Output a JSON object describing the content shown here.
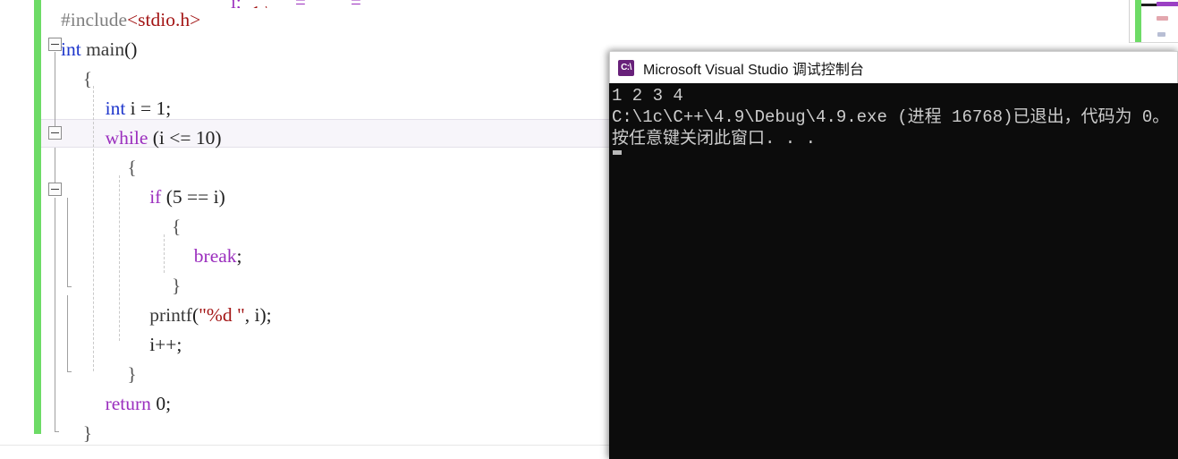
{
  "editor": {
    "name": "visual-studio-code-editor",
    "clipped_top_fragment": "i;  =    = ;",
    "lines": [
      {
        "indent": 0,
        "tokens": [
          {
            "t": "#include",
            "c": "tk-pre"
          },
          {
            "t": "<stdio.h>",
            "c": "tk-inc"
          }
        ]
      },
      {
        "indent": 0,
        "tokens": [
          {
            "t": "int",
            "c": "tk-type"
          },
          {
            "t": " ",
            "c": "tk-plain"
          },
          {
            "t": "main",
            "c": "tk-fn"
          },
          {
            "t": "()",
            "c": "tk-plain"
          }
        ]
      },
      {
        "indent": 1,
        "tokens": [
          {
            "t": "{",
            "c": "tk-brace"
          }
        ]
      },
      {
        "indent": 2,
        "tokens": [
          {
            "t": "int",
            "c": "tk-type"
          },
          {
            "t": " i = ",
            "c": "tk-plain"
          },
          {
            "t": "1",
            "c": "tk-num"
          },
          {
            "t": ";",
            "c": "tk-plain"
          }
        ]
      },
      {
        "indent": 2,
        "tokens": [
          {
            "t": "while",
            "c": "tk-kw"
          },
          {
            "t": " (i <= ",
            "c": "tk-plain"
          },
          {
            "t": "10",
            "c": "tk-num"
          },
          {
            "t": ")",
            "c": "tk-plain"
          }
        ]
      },
      {
        "indent": 3,
        "tokens": [
          {
            "t": "{",
            "c": "tk-brace"
          }
        ]
      },
      {
        "indent": 4,
        "tokens": [
          {
            "t": "if",
            "c": "tk-kw"
          },
          {
            "t": " (",
            "c": "tk-plain"
          },
          {
            "t": "5",
            "c": "tk-num"
          },
          {
            "t": " == i)",
            "c": "tk-plain"
          }
        ]
      },
      {
        "indent": 5,
        "tokens": [
          {
            "t": "{",
            "c": "tk-brace"
          }
        ]
      },
      {
        "indent": 6,
        "tokens": [
          {
            "t": "break",
            "c": "tk-kw"
          },
          {
            "t": ";",
            "c": "tk-plain"
          }
        ]
      },
      {
        "indent": 5,
        "tokens": [
          {
            "t": "}",
            "c": "tk-brace"
          }
        ]
      },
      {
        "indent": 4,
        "tokens": [
          {
            "t": "printf",
            "c": "tk-fn"
          },
          {
            "t": "(",
            "c": "tk-plain"
          },
          {
            "t": "\"%d \"",
            "c": "tk-str"
          },
          {
            "t": ", i);",
            "c": "tk-plain"
          }
        ]
      },
      {
        "indent": 4,
        "tokens": [
          {
            "t": "i++;",
            "c": "tk-plain"
          }
        ]
      },
      {
        "indent": 3,
        "tokens": [
          {
            "t": "}",
            "c": "tk-brace"
          }
        ]
      },
      {
        "indent": 2,
        "tokens": [
          {
            "t": "return",
            "c": "tk-kw"
          },
          {
            "t": " ",
            "c": "tk-plain"
          },
          {
            "t": "0",
            "c": "tk-num"
          },
          {
            "t": ";",
            "c": "tk-plain"
          }
        ]
      },
      {
        "indent": 1,
        "tokens": [
          {
            "t": "}",
            "c": "tk-brace"
          }
        ]
      }
    ],
    "current_line_index": 4,
    "change_bar_color": "#6ddb66"
  },
  "console": {
    "title": "Microsoft Visual Studio 调试控制台",
    "icon": "visual-studio-console-icon",
    "icon_glyph": "C:\\",
    "background_color": "#0c0c0c",
    "text_color": "#cccccc",
    "lines": [
      "1 2 3 4",
      "C:\\1c\\C++\\4.9\\Debug\\4.9.exe (进程 16768)已退出，代码为 0。",
      "按任意键关闭此窗口. . ."
    ]
  }
}
